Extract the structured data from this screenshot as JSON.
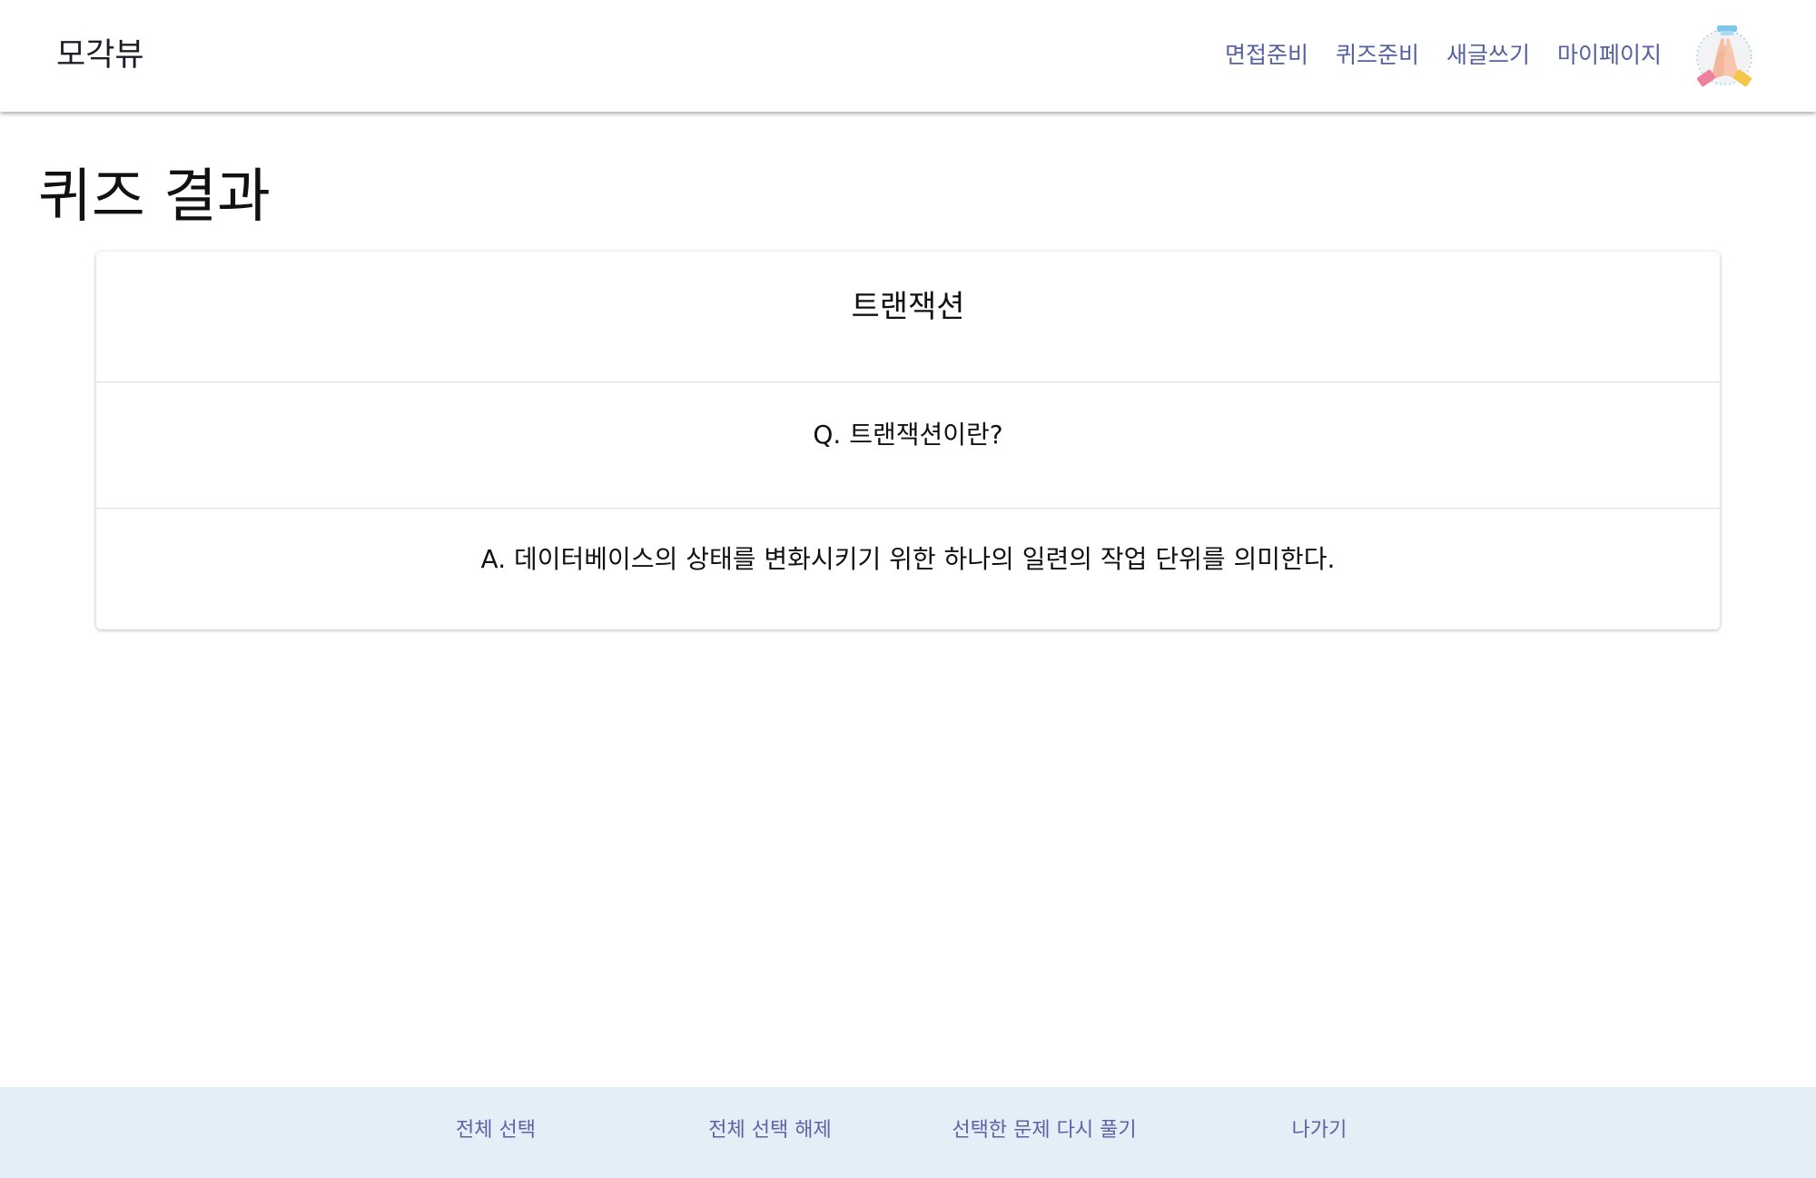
{
  "header": {
    "brand": "모각뷰",
    "nav": [
      {
        "label": "면접준비"
      },
      {
        "label": "퀴즈준비"
      },
      {
        "label": "새글쓰기"
      },
      {
        "label": "마이페이지"
      }
    ],
    "avatar_icon": "high-five-hands-icon"
  },
  "page": {
    "title": "퀴즈 결과"
  },
  "quiz_card": {
    "topic": "트랜잭션",
    "question": "Q. 트랜잭션이란?",
    "answer": "A. 데이터베이스의 상태를 변화시키기 위한 하나의 일련의 작업 단위를 의미한다."
  },
  "footer": {
    "select_all": "전체 선택",
    "deselect_all": "전체 선택 해제",
    "retry_selected": "선택한 문제 다시 풀기",
    "exit": "나가기"
  },
  "colors": {
    "nav_link": "#5560a0",
    "footer_bg": "#e3eef7",
    "footer_link": "#5a64a4"
  }
}
